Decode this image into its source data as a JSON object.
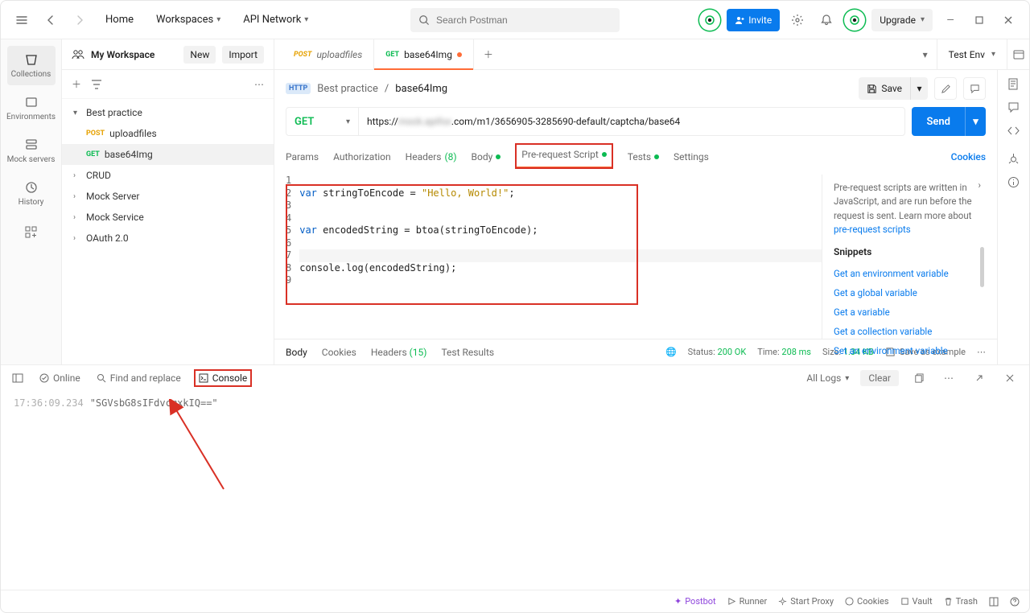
{
  "topbar": {
    "home": "Home",
    "workspaces": "Workspaces",
    "api_network": "API Network",
    "search_placeholder": "Search Postman",
    "invite": "Invite",
    "upgrade": "Upgrade"
  },
  "leftnav": {
    "collections": "Collections",
    "environments": "Environments",
    "mock_servers": "Mock servers",
    "history": "History"
  },
  "sidebar": {
    "workspace": "My Workspace",
    "new": "New",
    "import": "Import",
    "tree": {
      "best_practice": "Best practice",
      "uploadfiles": "uploadfiles",
      "base64img": "base64Img",
      "crud": "CRUD",
      "mock_server": "Mock Server",
      "mock_service": "Mock Service",
      "oauth": "OAuth 2.0"
    }
  },
  "tabs": {
    "t1_method": "POST",
    "t1_name": "uploadfiles",
    "t2_method": "GET",
    "t2_name": "base64Img",
    "env": "Test Env"
  },
  "breadcrumb": {
    "http": "HTTP",
    "collection": "Best practice",
    "request": "base64Img",
    "save": "Save"
  },
  "url": {
    "method": "GET",
    "prefix": "https://",
    "blurred": "mock.apifox",
    "suffix": ".com/m1/3656905-3285690-default/captcha/base64",
    "send": "Send"
  },
  "subtabs": {
    "params": "Params",
    "authorization": "Authorization",
    "headers": "Headers",
    "headers_count": "(8)",
    "body": "Body",
    "prerequest": "Pre-request Script",
    "tests": "Tests",
    "settings": "Settings",
    "cookies": "Cookies"
  },
  "code": {
    "l1": "",
    "l2_kw": "var",
    "l2_rest": " stringToEncode = ",
    "l2_str": "\"Hello, World!\"",
    "l2_end": ";",
    "l3": "",
    "l4": "",
    "l5_kw": "var",
    "l5_rest": " encodedString = btoa(stringToEncode);",
    "l6": "",
    "l7": "",
    "l8": "console.log(encodedString);",
    "l9": ""
  },
  "snippets": {
    "desc1": "Pre-request scripts are written in JavaScript, and are run before the request is sent. Learn more about ",
    "desc_link": "pre-request scripts",
    "heading": "Snippets",
    "items": [
      "Get an environment variable",
      "Get a global variable",
      "Get a variable",
      "Get a collection variable",
      "Set an environment variable"
    ]
  },
  "response": {
    "body": "Body",
    "cookies": "Cookies",
    "headers": "Headers",
    "headers_count": "(15)",
    "test_results": "Test Results",
    "status_label": "Status:",
    "status_val": "200 OK",
    "time_label": "Time:",
    "time_val": "208 ms",
    "size_label": "Size:",
    "size_val": "1.34 KB",
    "save_example": "Save as example"
  },
  "console": {
    "online": "Online",
    "find_replace": "Find and replace",
    "console": "Console",
    "all_logs": "All Logs",
    "clear": "Clear",
    "timestamp": "17:36:09.234",
    "output": "\"SGVsbG8sIFdvcmxkIQ==\""
  },
  "footer": {
    "postbot": "Postbot",
    "runner": "Runner",
    "start_proxy": "Start Proxy",
    "cookies": "Cookies",
    "vault": "Vault",
    "trash": "Trash"
  }
}
